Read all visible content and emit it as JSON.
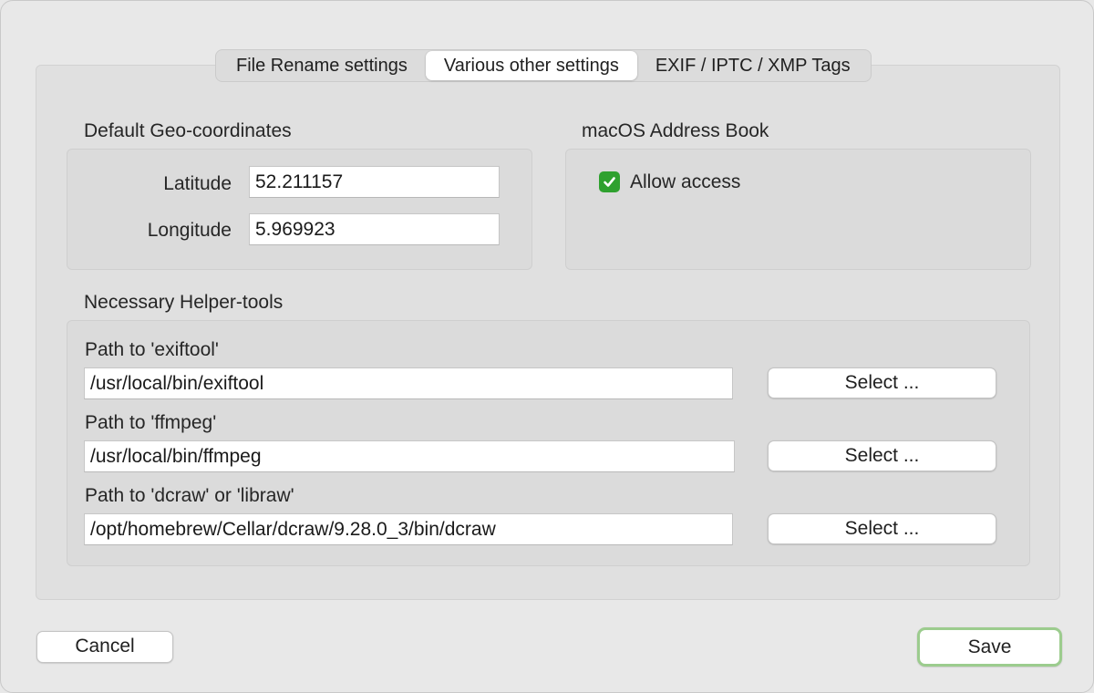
{
  "tabs": [
    {
      "label": "File Rename settings",
      "active": false
    },
    {
      "label": "Various other settings",
      "active": true
    },
    {
      "label": "EXIF / IPTC / XMP Tags",
      "active": false
    }
  ],
  "geo": {
    "title": "Default Geo-coordinates",
    "latitude_label": "Latitude",
    "latitude_value": "52.211157",
    "longitude_label": "Longitude",
    "longitude_value": "5.969923"
  },
  "addressbook": {
    "title": "macOS Address Book",
    "allow_label": "Allow access",
    "allow_checked": true
  },
  "helpers": {
    "title": "Necessary Helper-tools",
    "tools": [
      {
        "label": "Path to 'exiftool'",
        "value": "/usr/local/bin/exiftool",
        "button": "Select ..."
      },
      {
        "label": "Path to 'ffmpeg'",
        "value": "/usr/local/bin/ffmpeg",
        "button": "Select ..."
      },
      {
        "label": "Path to 'dcraw' or 'libraw'",
        "value": "/opt/homebrew/Cellar/dcraw/9.28.0_3/bin/dcraw",
        "button": "Select ..."
      }
    ]
  },
  "footer": {
    "cancel_label": "Cancel",
    "save_label": "Save"
  },
  "colors": {
    "checkbox": "#2fa12f",
    "default_button_ring": "#9ccc8e"
  }
}
